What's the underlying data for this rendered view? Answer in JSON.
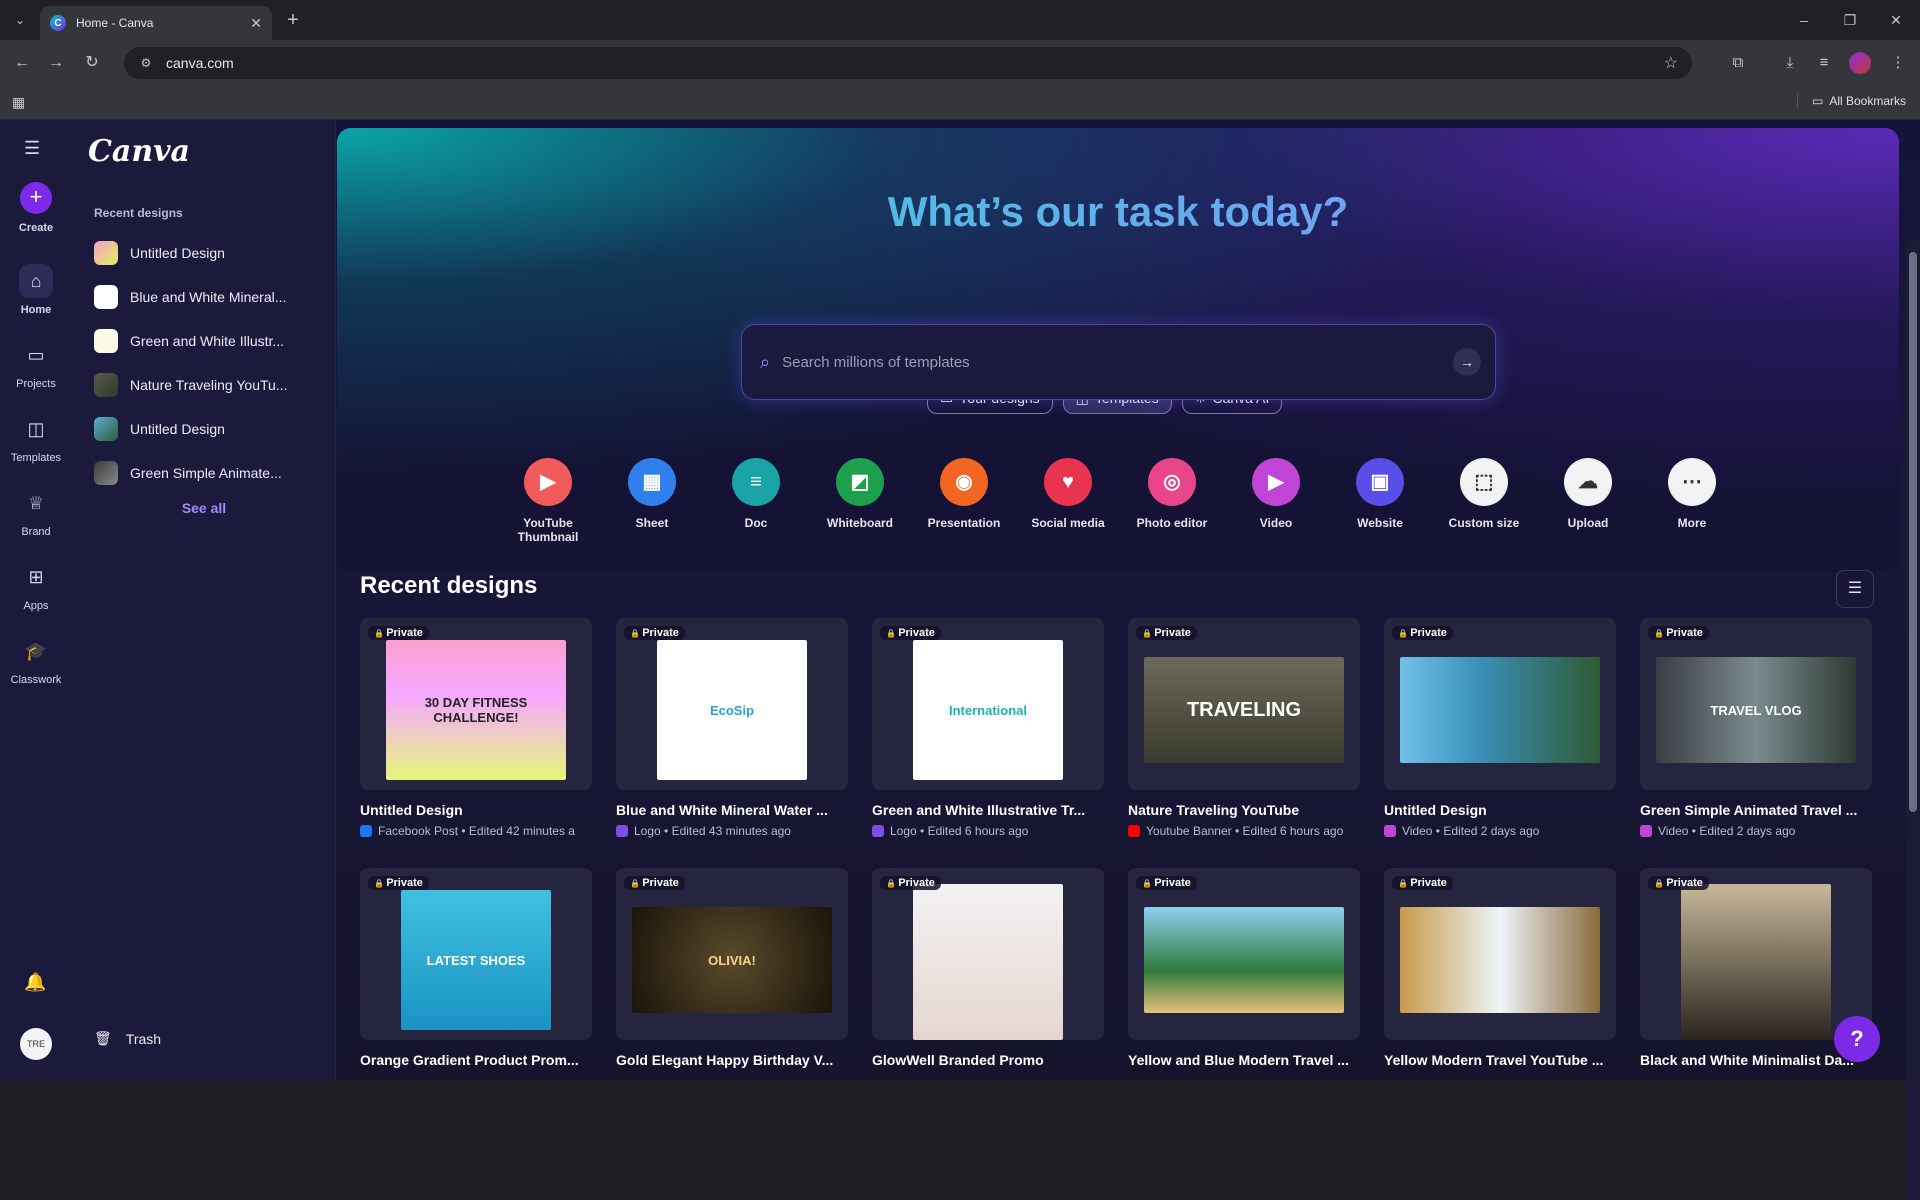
{
  "browser": {
    "tab_title": "Home - Canva",
    "url": "canva.com",
    "all_bookmarks": "All Bookmarks"
  },
  "rail": {
    "items": [
      {
        "label": "Create"
      },
      {
        "label": "Home"
      },
      {
        "label": "Projects"
      },
      {
        "label": "Templates"
      },
      {
        "label": "Brand"
      },
      {
        "label": "Apps"
      },
      {
        "label": "Classwork"
      }
    ],
    "avatar_text": "TRE"
  },
  "sidebar": {
    "logo": "Canva",
    "heading": "Recent designs",
    "items": [
      {
        "label": "Untitled Design"
      },
      {
        "label": "Blue and White Mineral..."
      },
      {
        "label": "Green and White Illustr..."
      },
      {
        "label": "Nature Traveling YouTu..."
      },
      {
        "label": "Untitled Design"
      },
      {
        "label": "Green Simple Animate..."
      }
    ],
    "see_all": "See all",
    "trash": "Trash"
  },
  "hero": {
    "title": "What’s our task today?",
    "tabs": [
      {
        "label": "Your designs"
      },
      {
        "label": "Templates"
      },
      {
        "label": "Canva AI"
      }
    ],
    "search_placeholder": "Search millions of templates"
  },
  "quick": [
    {
      "label": "YouTube Thumbnail",
      "color": "#f25b5b"
    },
    {
      "label": "Sheet",
      "color": "#2f80ed"
    },
    {
      "label": "Doc",
      "color": "#1aa3a6"
    },
    {
      "label": "Whiteboard",
      "color": "#1e9f4c"
    },
    {
      "label": "Presentation",
      "color": "#f26522"
    },
    {
      "label": "Social media",
      "color": "#e8344e"
    },
    {
      "label": "Photo editor",
      "color": "#e8458b"
    },
    {
      "label": "Video",
      "color": "#c044d6"
    },
    {
      "label": "Website",
      "color": "#5a4ee8"
    },
    {
      "label": "Custom size",
      "color": "#f2f2f2"
    },
    {
      "label": "Upload",
      "color": "#f2f2f2"
    },
    {
      "label": "More",
      "color": "#f2f2f2"
    }
  ],
  "recent": {
    "title": "Recent designs",
    "private_label": "Private",
    "cards": [
      {
        "title": "Untitled Design",
        "meta": "Facebook Post • Edited 42 minutes a",
        "meta_color": "#1877f2"
      },
      {
        "title": "Blue and White Mineral Water ...",
        "meta": "Logo • Edited 43 minutes ago",
        "meta_color": "#7d4ee8"
      },
      {
        "title": "Green and White Illustrative Tr...",
        "meta": "Logo • Edited 6 hours ago",
        "meta_color": "#7d4ee8"
      },
      {
        "title": "Nature Traveling YouTube",
        "meta": "Youtube Banner • Edited 6 hours ago",
        "meta_color": "#ff0000"
      },
      {
        "title": "Untitled Design",
        "meta": "Video • Edited 2 days ago",
        "meta_color": "#c044d6"
      },
      {
        "title": "Green Simple Animated Travel ...",
        "meta": "Video • Edited 2 days ago",
        "meta_color": "#c044d6"
      },
      {
        "title": "Orange Gradient Product Prom...",
        "meta": "",
        "meta_color": ""
      },
      {
        "title": "Gold Elegant Happy Birthday V...",
        "meta": "",
        "meta_color": ""
      },
      {
        "title": "GlowWell Branded Promo",
        "meta": "",
        "meta_color": ""
      },
      {
        "title": "Yellow and Blue Modern Travel ...",
        "meta": "",
        "meta_color": ""
      },
      {
        "title": "Yellow Modern Travel YouTube ...",
        "meta": "",
        "meta_color": ""
      },
      {
        "title": "Black and White Minimalist Da...",
        "meta": "",
        "meta_color": ""
      }
    ]
  },
  "thumb_text": {
    "fitness": "30 DAY FITNESS CHALLENGE!",
    "ecosip": "EcoSip",
    "international": "International",
    "traveling": "TRAVELING",
    "travel_vlog": "TRAVEL VLOG",
    "shoes": "LATEST SHOES",
    "olivia": "OLIVIA!"
  },
  "help_label": "?"
}
